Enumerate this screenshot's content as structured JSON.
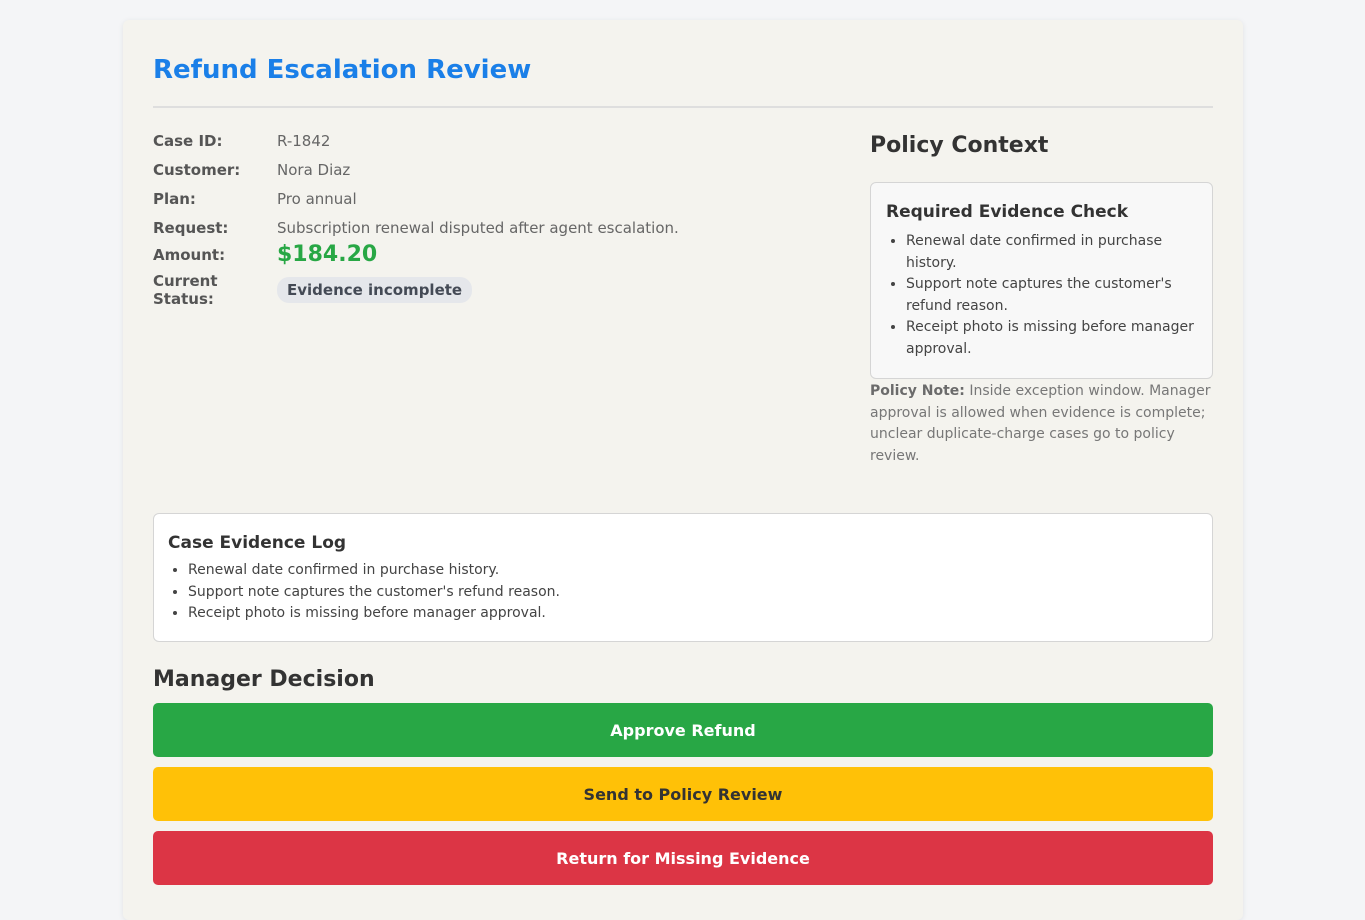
{
  "page": {
    "title": "Refund Escalation Review"
  },
  "case": {
    "fields": [
      {
        "label": "Case ID:",
        "value": "R-1842"
      },
      {
        "label": "Customer:",
        "value": "Nora Diaz"
      },
      {
        "label": "Plan:",
        "value": "Pro annual"
      },
      {
        "label": "Request:",
        "value": "Subscription renewal disputed after agent escalation."
      }
    ],
    "amount_label": "Amount:",
    "amount_value": "$184.20",
    "status_label": "Current Status:",
    "status_value": "Evidence incomplete"
  },
  "policy": {
    "heading": "Policy Context",
    "check_heading": "Required Evidence Check",
    "check_items": [
      "Renewal date confirmed in purchase history.",
      "Support note captures the customer's refund reason.",
      "Receipt photo is missing before manager approval."
    ],
    "note_label": "Policy Note:",
    "note_text": "Inside exception window. Manager approval is allowed when evidence is complete; unclear duplicate-charge cases go to policy review."
  },
  "evidence_log": {
    "heading": "Case Evidence Log",
    "items": [
      "Renewal date confirmed in purchase history.",
      "Support note captures the customer's refund reason.",
      "Receipt photo is missing before manager approval."
    ]
  },
  "decision": {
    "heading": "Manager Decision",
    "approve_label": "Approve Refund",
    "policy_review_label": "Send to Policy Review",
    "return_label": "Return for Missing Evidence"
  },
  "colors": {
    "title": "#1a7fe8",
    "amount": "#28a745",
    "approve": "#28a745",
    "policy_review": "#ffc107",
    "return": "#dc3545"
  }
}
